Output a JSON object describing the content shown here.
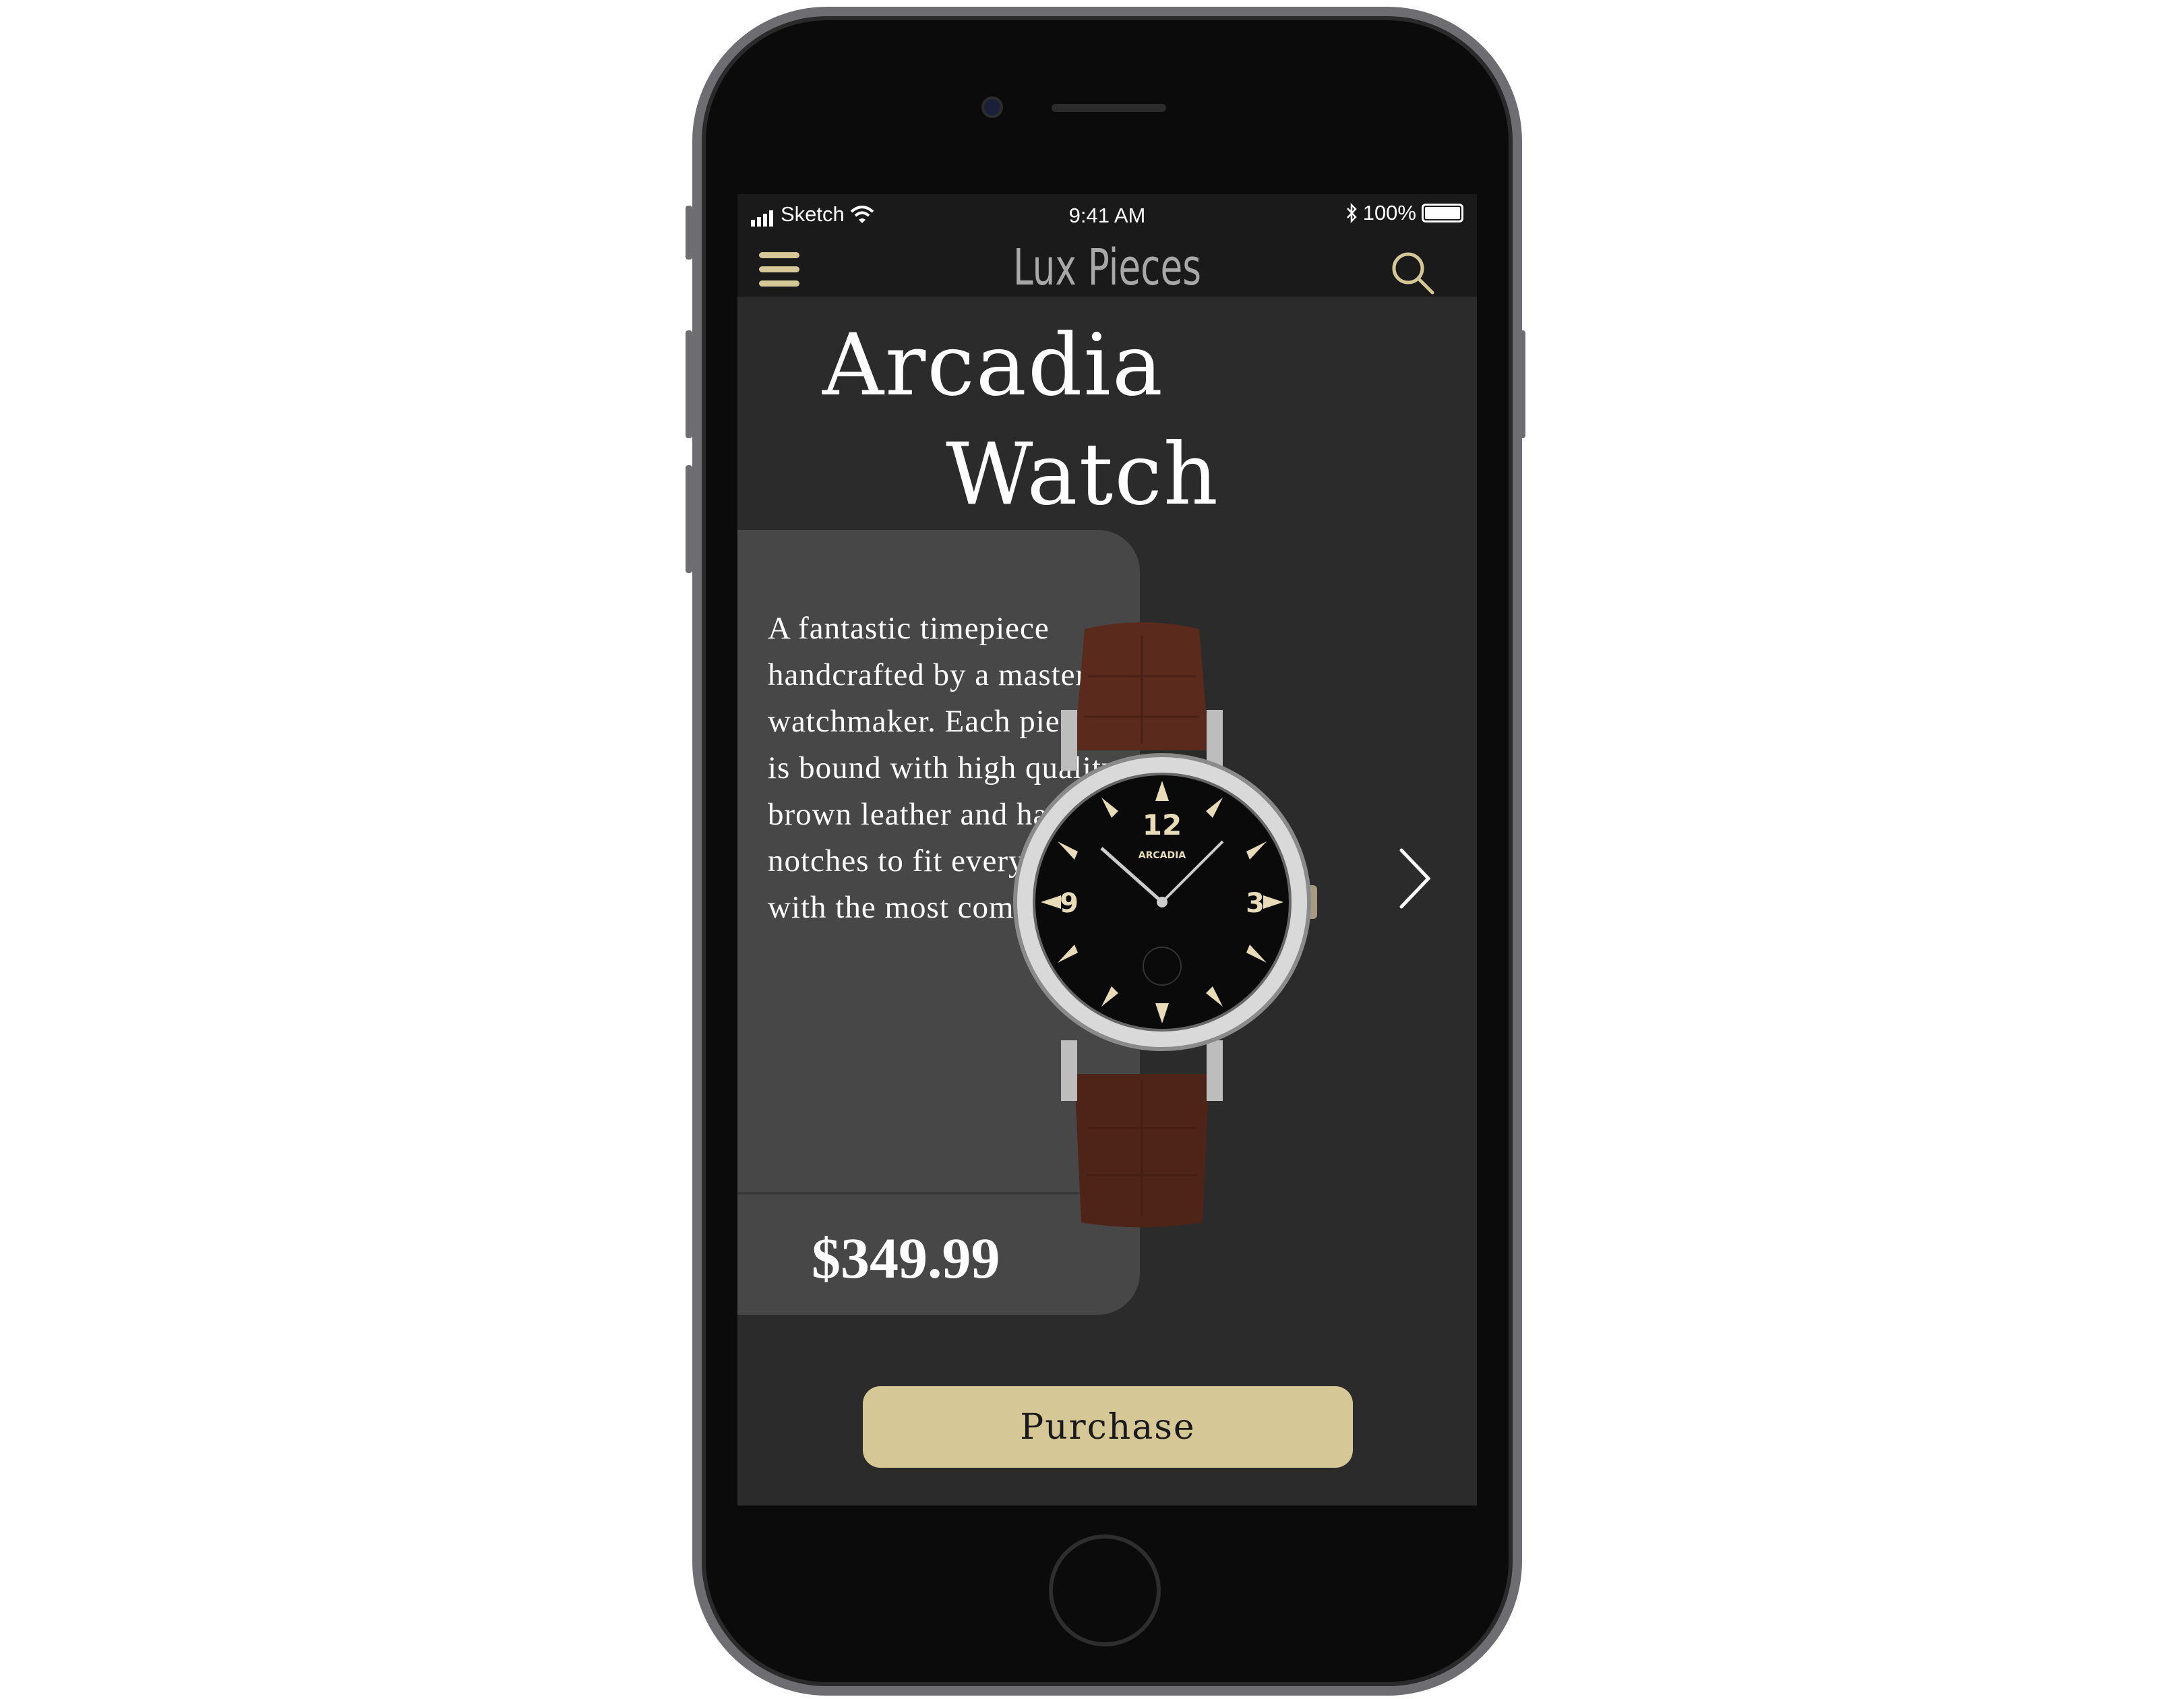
{
  "status_bar": {
    "carrier": "Sketch",
    "time": "9:41 AM",
    "battery": "100%",
    "battery_level": 1.0
  },
  "nav": {
    "title": "Lux Pieces",
    "menu_icon": "hamburger-icon",
    "search_icon": "search-icon"
  },
  "product": {
    "title_line1": "Arcadia",
    "title_line2": "Watch",
    "description": "A fantastic timepiece handcrafted by a master watchmaker. Each piece is bound with high quality brown leather and has six notches to fit every wrist with the most comfort.",
    "price": "$349.99",
    "dial_brand": "ARCADIA",
    "next_icon": "chevron-right-icon"
  },
  "actions": {
    "purchase_label": "Purchase"
  },
  "colors": {
    "accent": "#d6c796",
    "background": "#2b2b2b",
    "card": "#474747",
    "bar": "#1a1a1a"
  }
}
